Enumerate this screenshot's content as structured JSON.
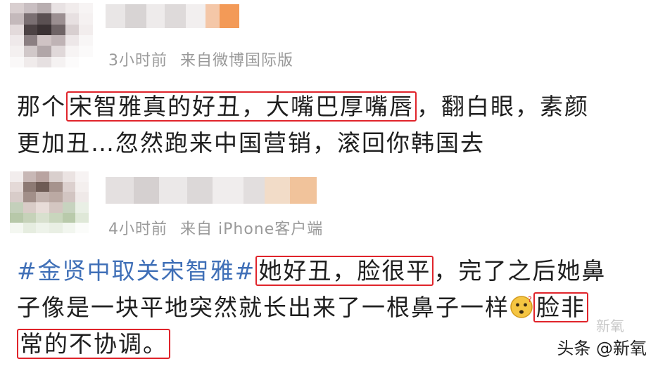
{
  "comments": [
    {
      "time": "3小时前",
      "source": "来自微博国际版",
      "lines": [
        [
          {
            "t": "那个",
            "hl": false
          },
          {
            "t": "宋智雅真的好丑，大嘴巴厚嘴唇",
            "hl": true
          },
          {
            "t": "，翻白眼，素颜",
            "hl": false
          }
        ],
        [
          {
            "t": "更加丑…忽然跑来中国营销，滚回你韩国去",
            "hl": false
          }
        ]
      ]
    },
    {
      "time": "4小时前",
      "source": "来自 iPhone客户端",
      "hashtag": "#金贤中取关宋智雅#",
      "lines": [
        [
          {
            "t": "她好丑，脸很平",
            "hl": true
          },
          {
            "t": "，完了之后她鼻",
            "hl": false
          }
        ],
        [
          {
            "t": "子像是一块平地突然就长出来了一根鼻子一样",
            "hl": false
          }
        ],
        [
          {
            "t": "常的不协调。",
            "hl": true
          }
        ]
      ],
      "line2_tail": "脸非",
      "emoji_icon": "thinking-face-icon"
    }
  ],
  "watermark": {
    "text": "头条 @新氧",
    "faint": "新氧"
  }
}
